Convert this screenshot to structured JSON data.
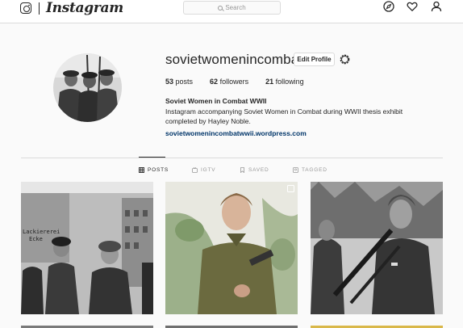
{
  "header": {
    "wordmark": "Instagram",
    "search_placeholder": "Search",
    "nav_icons": [
      "compass-icon",
      "heart-icon",
      "profile-icon"
    ]
  },
  "profile": {
    "username": "sovietwomenincombat",
    "edit_label": "Edit Profile",
    "stats": {
      "posts_count": "53",
      "posts_label": "posts",
      "followers_count": "62",
      "followers_label": "followers",
      "following_count": "21",
      "following_label": "following"
    },
    "full_name": "Soviet Women in Combat WWII",
    "bio_line1": "Instagram accompanying Soviet Women in Combat during WWII thesis exhibit",
    "bio_line2": "completed by Hayley Noble.",
    "website": "sovietwomenincombatwwii.wordpress.com"
  },
  "tabs": [
    {
      "label": "POSTS",
      "icon": "grid-icon",
      "active": true
    },
    {
      "label": "IGTV",
      "icon": "tv-icon",
      "active": false
    },
    {
      "label": "SAVED",
      "icon": "bookmark-icon",
      "active": false
    },
    {
      "label": "TAGGED",
      "icon": "tag-icon",
      "active": false
    }
  ],
  "posts": [
    {
      "kind": "bw-photo",
      "caption_text_in_photo": "Lackiererei Ecke"
    },
    {
      "kind": "color-portrait",
      "multiple": true
    },
    {
      "kind": "bw-photo"
    }
  ],
  "colors": {
    "background": "#fafafa",
    "border": "#dbdbdb",
    "text": "#262626",
    "muted": "#999999",
    "link": "#003569"
  }
}
